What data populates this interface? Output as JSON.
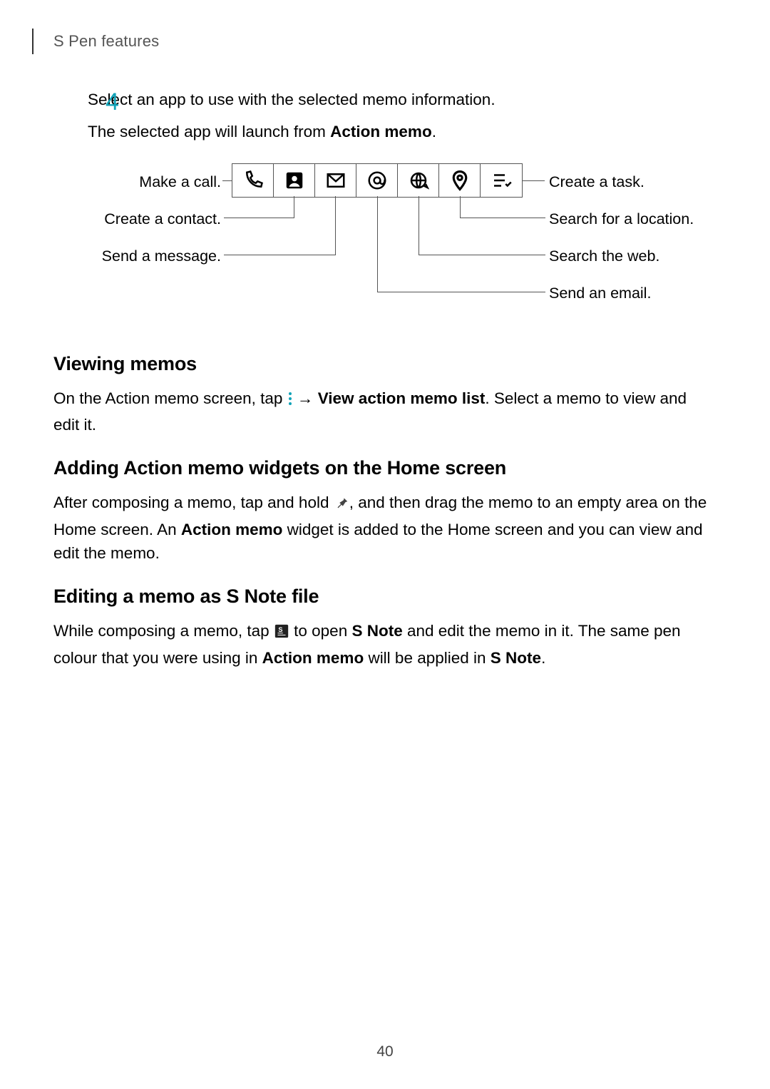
{
  "header": {
    "title": "S Pen features"
  },
  "step": {
    "number": "4",
    "line1": "Select an app to use with the selected memo information.",
    "line2_a": "The selected app will launch from ",
    "line2_bold": "Action memo",
    "line2_b": "."
  },
  "diagram": {
    "labels": {
      "make_call": "Make a call.",
      "create_contact": "Create a contact.",
      "send_message": "Send a message.",
      "create_task": "Create a task.",
      "search_location": "Search for a location.",
      "search_web": "Search the web.",
      "send_email": "Send an email."
    }
  },
  "section_view": {
    "heading": "Viewing memos",
    "p1_a": "On the Action memo screen, tap ",
    "p1_b": " → ",
    "p1_bold": "View action memo list",
    "p1_c": ". Select a memo to view and edit it."
  },
  "section_widget": {
    "heading": "Adding Action memo widgets on the Home screen",
    "p1_a": "After composing a memo, tap and hold ",
    "p1_b": ", and then drag the memo to an empty area on the Home screen. An ",
    "p1_bold": "Action memo",
    "p1_c": " widget is added to the Home screen and you can view and edit the memo."
  },
  "section_edit": {
    "heading": "Editing a memo as S Note file",
    "p1_a": "While composing a memo, tap ",
    "p1_b": " to open ",
    "p1_bold1": "S Note",
    "p1_c": " and edit the memo in it. The same pen colour that you were using in ",
    "p1_bold2": "Action memo",
    "p1_d": " will be applied in ",
    "p1_bold3": "S Note",
    "p1_e": "."
  },
  "footer": {
    "page": "40"
  }
}
